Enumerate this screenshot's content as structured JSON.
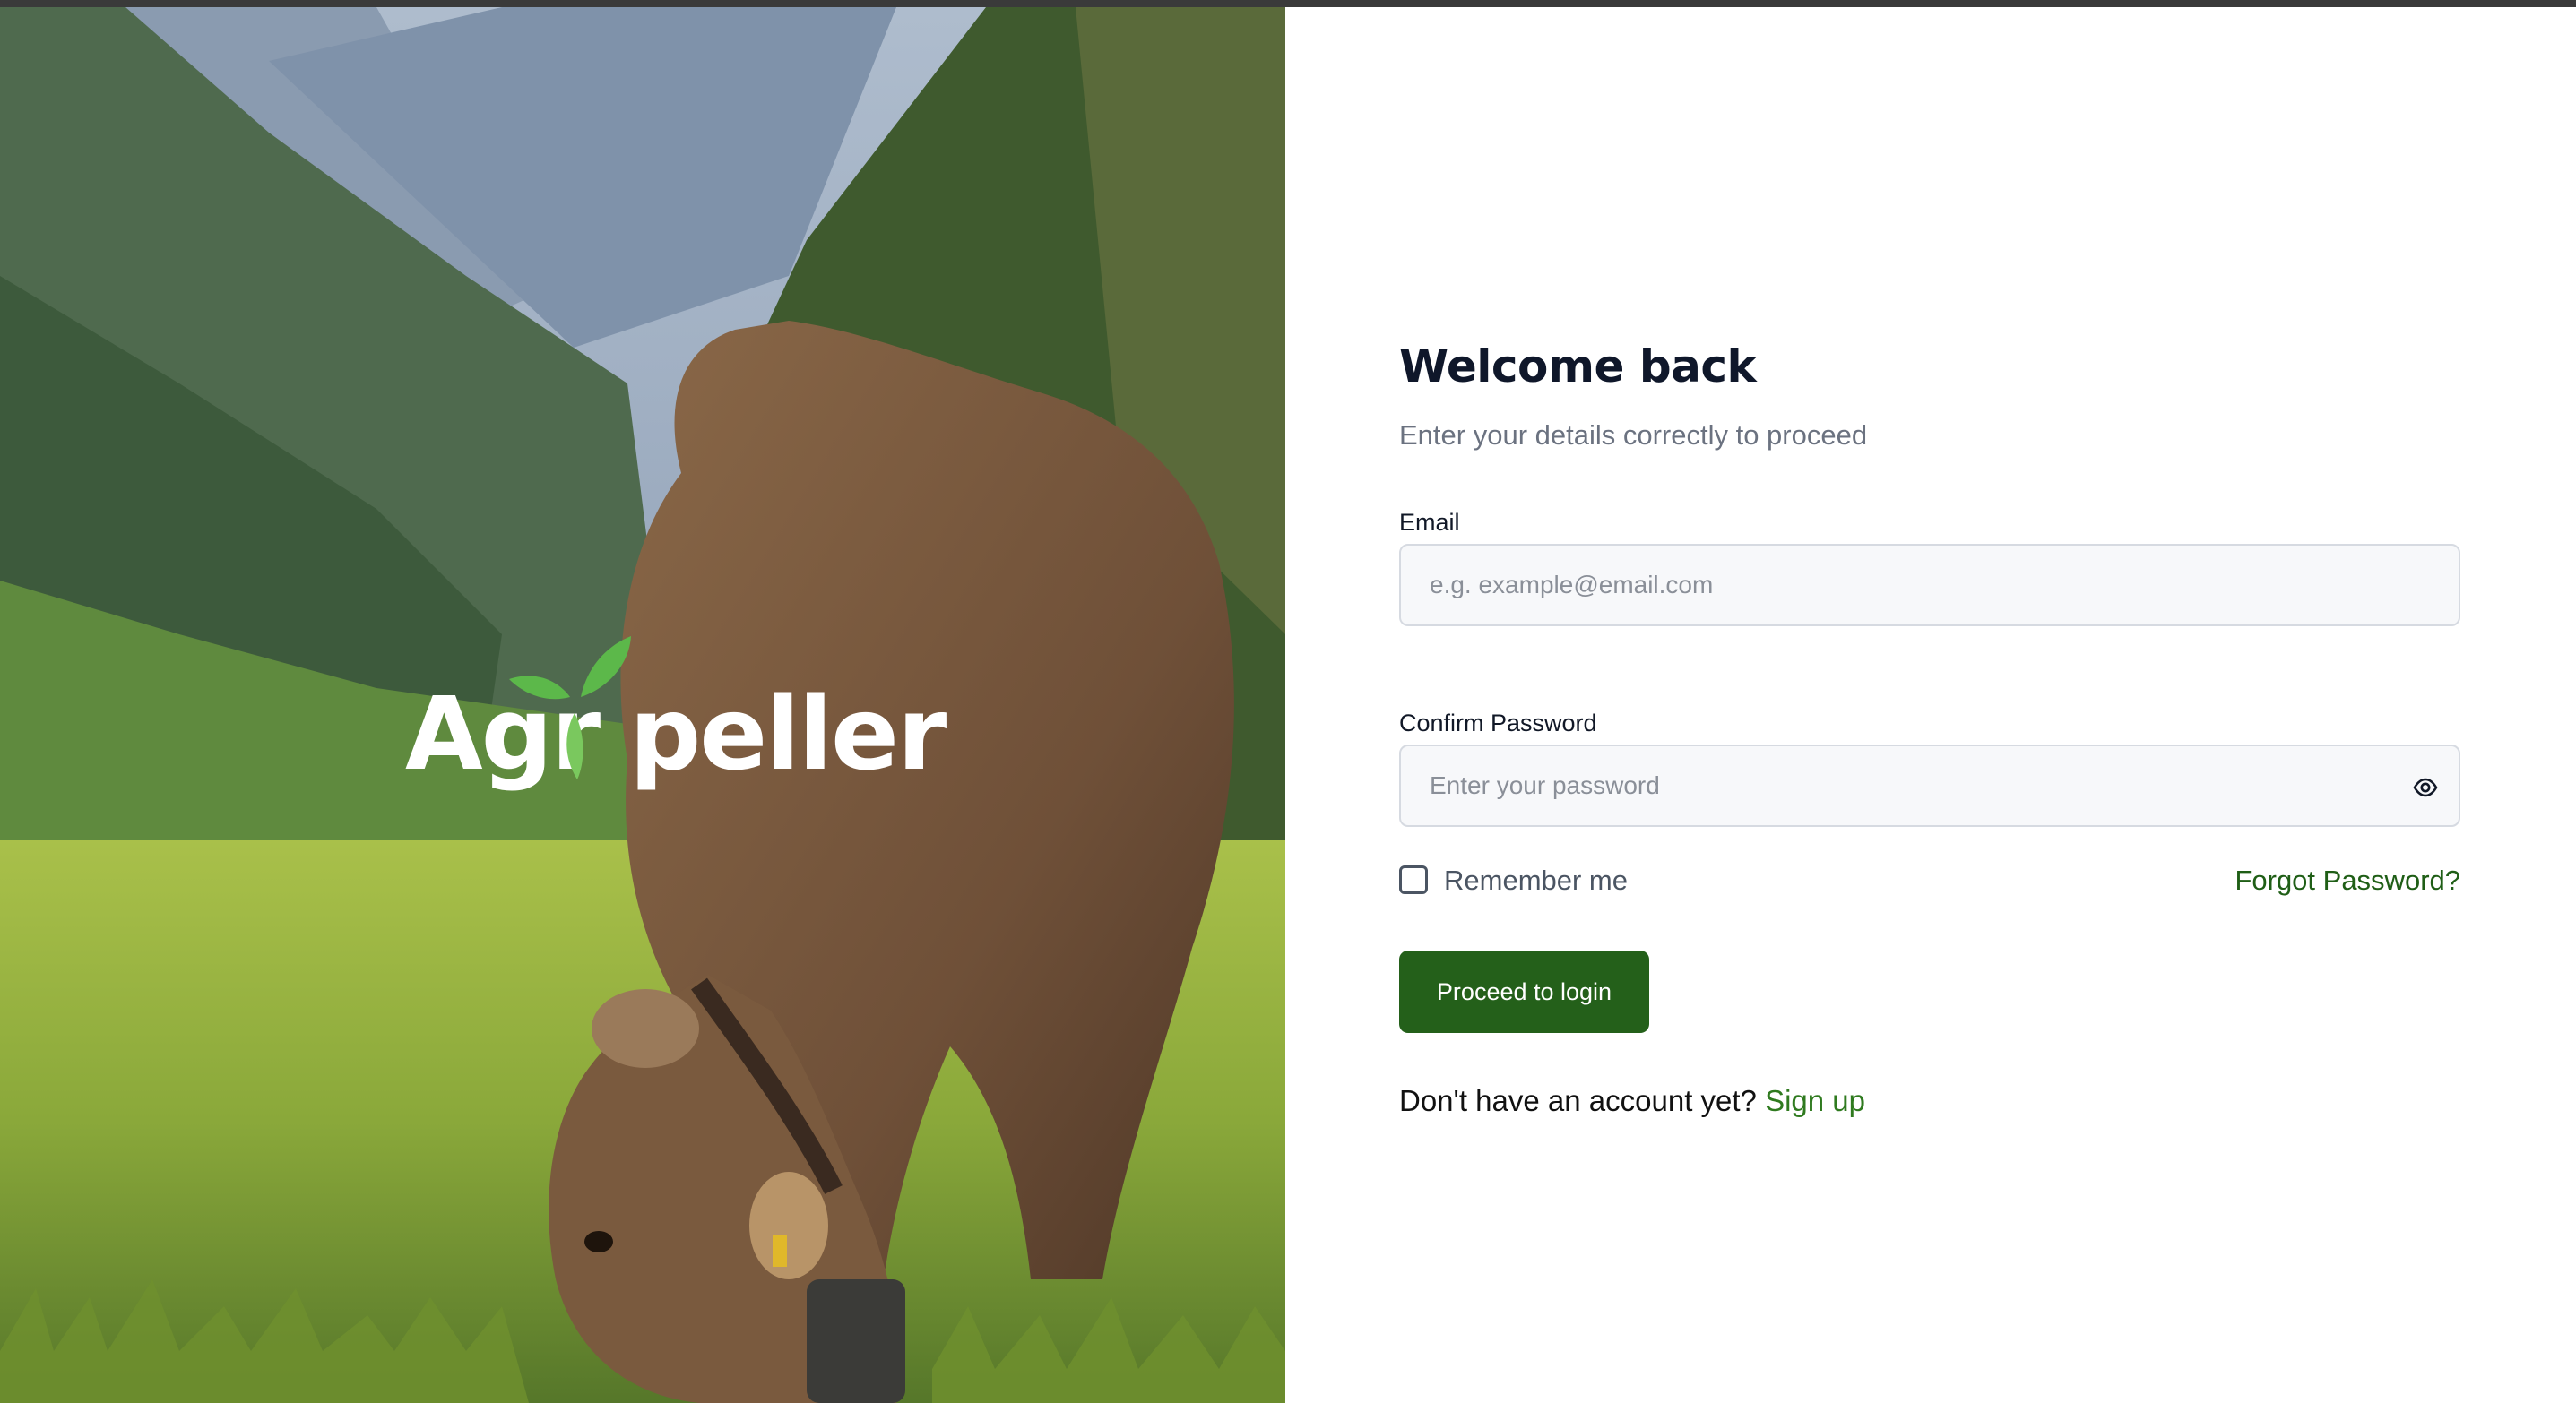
{
  "brand": {
    "name_prefix": "Agr",
    "name_suffix": "peller",
    "mark_colors": {
      "leaves": "#5cb84a",
      "stem": "#7ac85e"
    }
  },
  "form": {
    "title": "Welcome back",
    "subtitle": "Enter your details correctly to proceed",
    "email": {
      "label": "Email",
      "placeholder": "e.g. example@email.com",
      "value": ""
    },
    "password": {
      "label": "Confirm Password",
      "placeholder": "Enter your password",
      "value": "",
      "toggle_icon": "eye-icon"
    },
    "remember_me": {
      "label": "Remember me",
      "checked": false
    },
    "forgot_password": "Forgot Password?",
    "submit_label": "Proceed to login",
    "signup_prompt": "Don't have an account yet?",
    "signup_link": "Sign up"
  },
  "colors": {
    "primary": "#24601a",
    "link": "#1f5e16",
    "signup_link": "#2f7a1f",
    "title": "#0f172a",
    "muted": "#6b7280",
    "input_bg": "#f7f8fa",
    "input_border": "#d6dae1"
  }
}
